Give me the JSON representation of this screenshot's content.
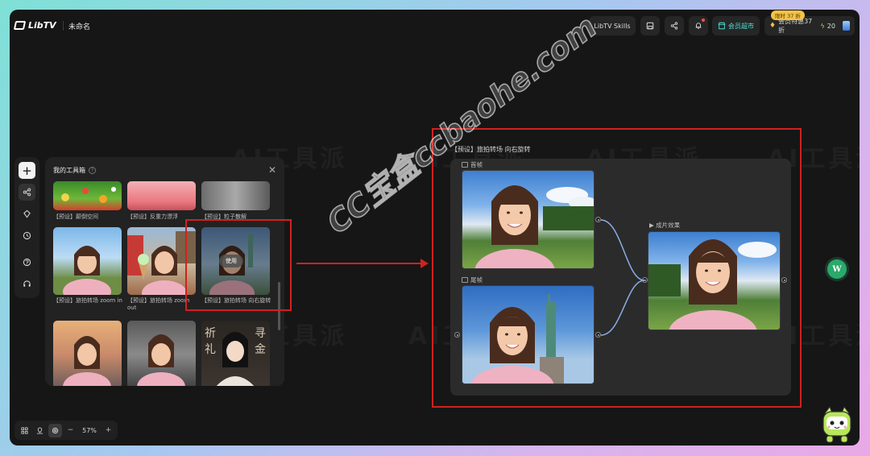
{
  "app": {
    "name": "LibTV",
    "doc_title": "未命名"
  },
  "header": {
    "skills_label": "LibTV Skills",
    "market_label": "会员超市",
    "vip_label": "会员特惠37折",
    "credits": "20",
    "promo_badge": "限时 37 折"
  },
  "toolbox": {
    "title": "我的工具箱",
    "items": [
      {
        "label": "【预设】颠倒空间"
      },
      {
        "label": "【预设】反重力漂浮"
      },
      {
        "label": "【预设】粒子散解"
      },
      {
        "label": "【预设】旅拍转场 zoom in"
      },
      {
        "label": "【预设】旅拍转场 zoom out"
      },
      {
        "label": "【预设】旅拍转场 向右旋转"
      }
    ],
    "use_label": "使用"
  },
  "canvas": {
    "group_title": "【预设】旅拍转场 向右旋转",
    "first_frame_label": "首帧",
    "last_frame_label": "尾帧",
    "result_label": "▶ 成片效果"
  },
  "bottom_bar": {
    "zoom": "57%"
  },
  "watermark": {
    "text": "AI工具派",
    "overlay": "CC宝盒ccbaohe.com"
  },
  "widget": {
    "letter": "W"
  },
  "colors": {
    "accent": "#4be3d6",
    "annotation": "#d0211f",
    "vip_gold": "#f4c247"
  }
}
